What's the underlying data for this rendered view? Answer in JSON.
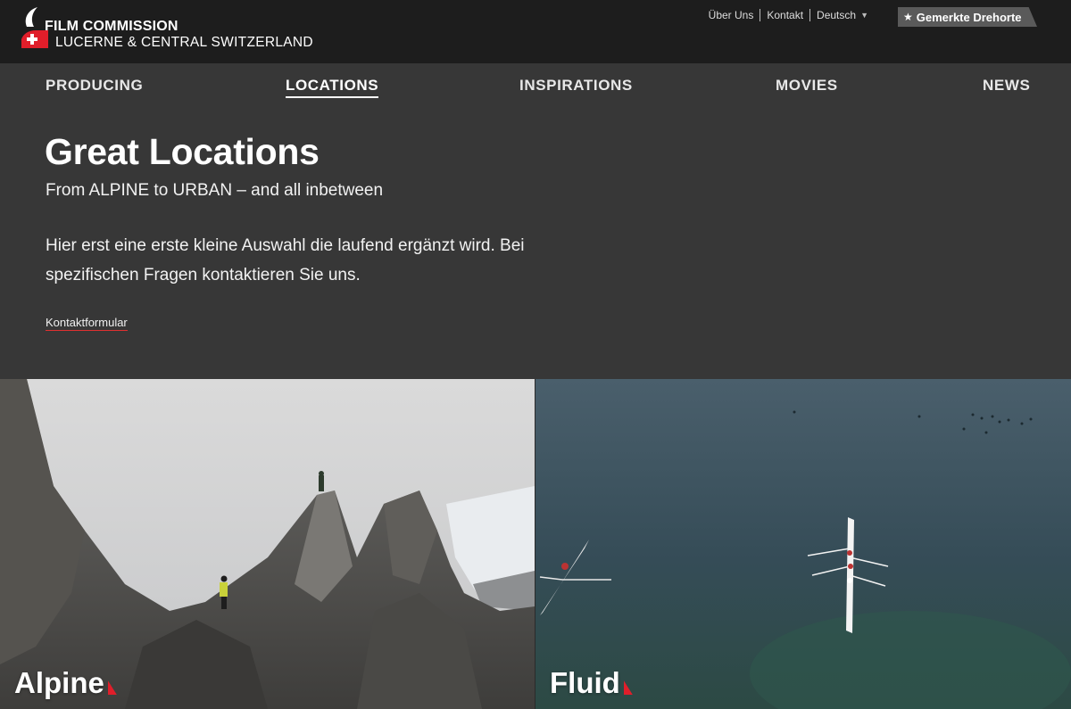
{
  "header": {
    "logo": {
      "line1": "FILM COMMISSION",
      "line2": "LUCERNE & CENTRAL SWITZERLAND"
    },
    "util_nav": [
      {
        "label": "Über Uns"
      },
      {
        "label": "Kontakt"
      },
      {
        "label": "Deutsch"
      }
    ],
    "bookmark_label": "Gemerkte Drehorte"
  },
  "nav": {
    "items": [
      {
        "label": "PRODUCING"
      },
      {
        "label": "LOCATIONS",
        "active": true
      },
      {
        "label": "INSPIRATIONS"
      },
      {
        "label": "MOVIES"
      },
      {
        "label": "NEWS"
      }
    ]
  },
  "hero": {
    "title": "Great Locations",
    "subtitle": "From ALPINE to URBAN – and all inbetween",
    "body": "Hier erst eine erste kleine Auswahl die laufend ergänzt wird. Bei spezifischen Fragen kontaktieren Sie uns.",
    "link": "Kontaktformular"
  },
  "tiles": [
    {
      "label": "Alpine"
    },
    {
      "label": "Fluid"
    }
  ],
  "colors": {
    "header_bg": "#1d1d1d",
    "nav_bg": "#373737",
    "accent_red": "#e01e2a"
  }
}
